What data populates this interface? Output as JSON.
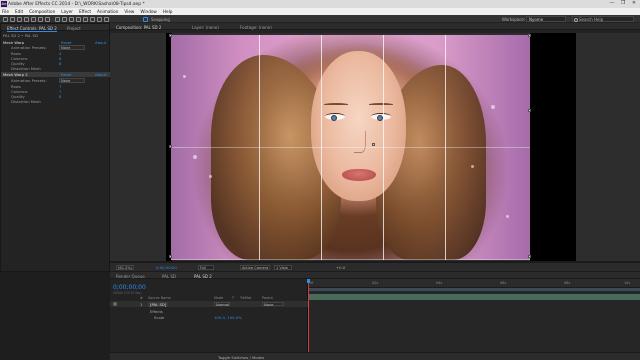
{
  "app": {
    "title": "Adobe After Effects CC 2014 - D:\\_WORK\\Sasha\\08-Tipsd.aep *",
    "icon_label": "Ae",
    "window_buttons": [
      "—",
      "❐",
      "✕"
    ]
  },
  "menu": [
    "File",
    "Edit",
    "Composition",
    "Layer",
    "Effect",
    "Animation",
    "View",
    "Window",
    "Help"
  ],
  "toolbar": {
    "snapping_label": "Snapping",
    "workspace_label": "Workspace:",
    "workspace_value": "Nyome",
    "search_placeholder": "Search Help"
  },
  "effect_controls": {
    "tabs": [
      "Effect Controls: PAL SD 2",
      "Project"
    ],
    "header": "PAL SD 2 • PAL SD",
    "effects": [
      {
        "name": "Mesh Warp",
        "reset_label": "Reset",
        "about_label": "About",
        "params": [
          {
            "label": "Animation Presets:",
            "value": "None"
          },
          {
            "label": "Rows",
            "value": "4"
          },
          {
            "label": "Columns",
            "value": "6"
          },
          {
            "label": "Quality",
            "value": "8"
          },
          {
            "label": "Distortion Mesh",
            "value": ""
          }
        ]
      },
      {
        "name": "Mesh Warp 2",
        "reset_label": "Reset",
        "about_label": "About",
        "params": [
          {
            "label": "Animation Presets:",
            "value": "None"
          },
          {
            "label": "Rows",
            "value": "7"
          },
          {
            "label": "Columns",
            "value": "7"
          },
          {
            "label": "Quality",
            "value": "8"
          },
          {
            "label": "Distortion Mesh",
            "value": ""
          }
        ]
      }
    ]
  },
  "composition": {
    "tabs": [
      "Composition: PAL SD 2",
      "Layer: (none)",
      "Footage: (none)"
    ],
    "sub_tab": "PAL SD 2"
  },
  "viewer_bar": {
    "zoom": "(61.2%)",
    "timecode": "0;00;00;00",
    "resolution": "Full",
    "camera": "Active Camera",
    "views": "1 View",
    "exposure": "+0.0"
  },
  "timeline": {
    "tabs": [
      "Render Queue",
      "PAL SD",
      "PAL SD 2"
    ],
    "timecode": "0;00;00;00",
    "timecode_sub": "00000 (29.97 fps)",
    "columns": [
      "#",
      "Source Name",
      "Mode",
      "T",
      "TrkMat",
      "Parent"
    ],
    "layers": [
      {
        "index": "1",
        "name": "[PAL SD]",
        "mode": "Normal",
        "parent": "None"
      }
    ],
    "sub_rows": [
      "Effects",
      "Scale"
    ],
    "scale_value": "100.0, 100.0%",
    "ruler": [
      "0f",
      "02s",
      "04s",
      "06s",
      "08s",
      "10s"
    ],
    "toggle_label": "Toggle Switches / Modes"
  }
}
